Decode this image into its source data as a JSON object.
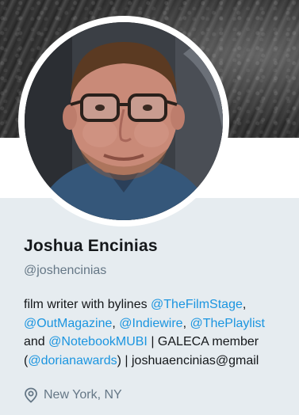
{
  "profile": {
    "name": "Joshua Encinias",
    "handle": "@joshencinias",
    "bio": {
      "l1_text": "film writer with bylines ",
      "l1_link": "@TheFilmStage",
      "l1_end": ",",
      "l2_link1": "@OutMagazine",
      "l2_sep1": ", ",
      "l2_link2": "@Indiewire",
      "l2_sep2": ", ",
      "l2_link3": "@ThePlaylist",
      "l3_text": "and ",
      "l3_link": "@NotebookMUBI",
      "l3_end": " | GALECA member",
      "l4_open": "(",
      "l4_link": "@dorianawards",
      "l4_end": ") | joshuaencinias@gmail"
    },
    "location": "New York, NY"
  },
  "icons": {
    "location": "map-pin-icon"
  },
  "colors": {
    "link": "#1b95e0",
    "name": "#14171a",
    "secondary": "#657786",
    "background": "#e6ecf0"
  }
}
